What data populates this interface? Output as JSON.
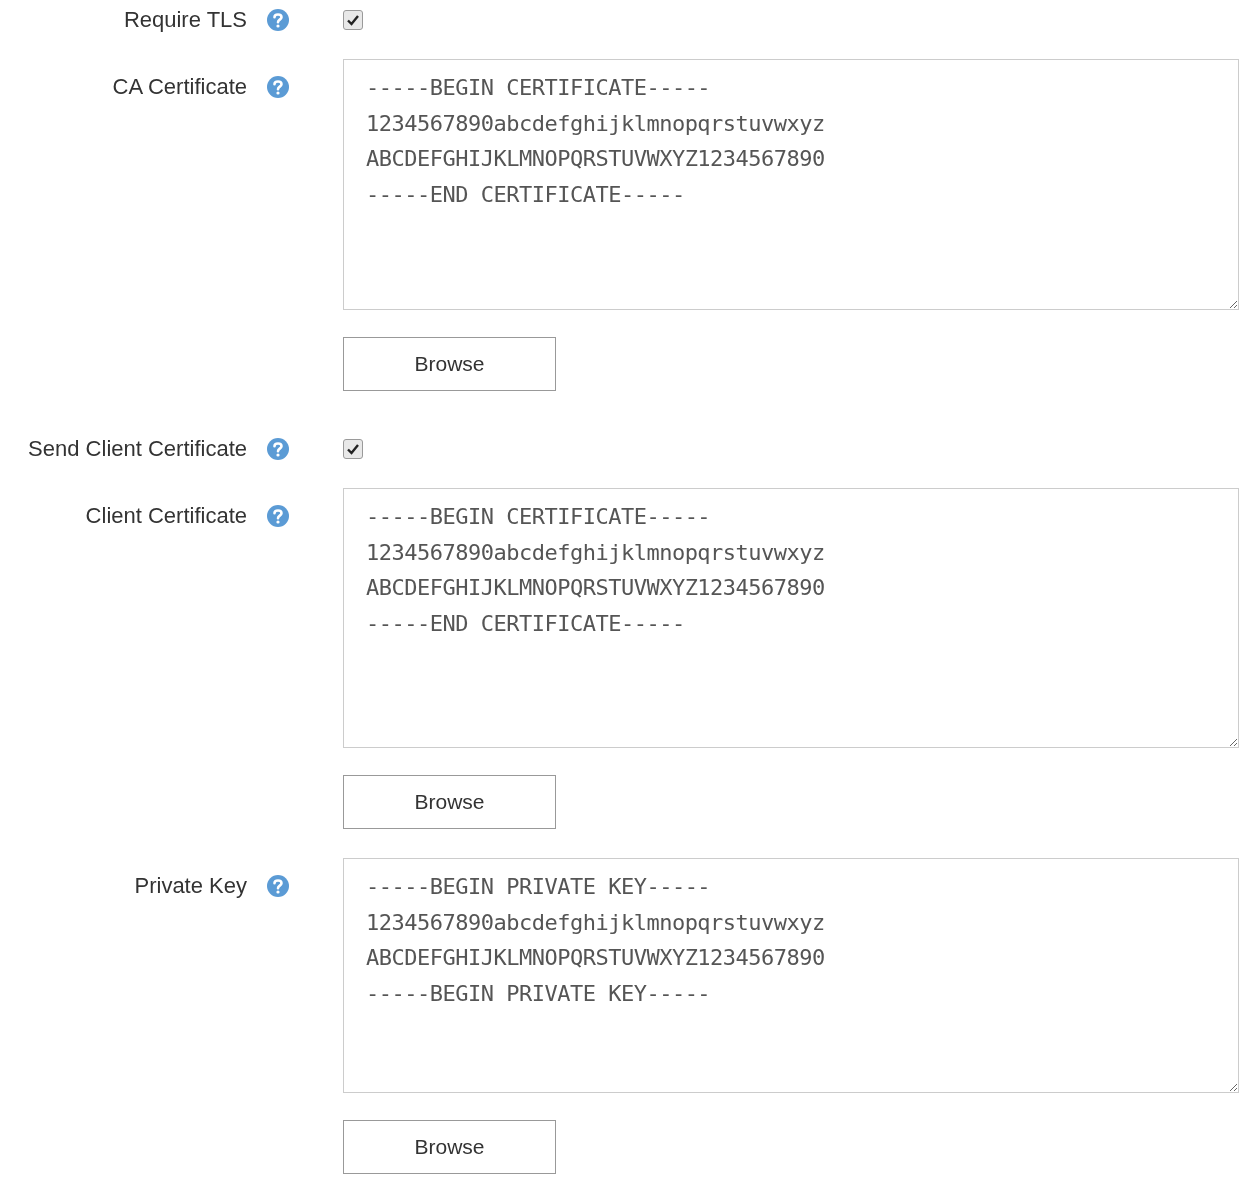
{
  "fields": [
    {
      "kind": "checkbox",
      "label": "Require TLS",
      "checked": true
    },
    {
      "kind": "textarea",
      "label": "CA Certificate",
      "value": "-----BEGIN CERTIFICATE-----\n1234567890abcdefghijklmnopqrstuvwxyz\nABCDEFGHIJKLMNOPQRSTUVWXYZ1234567890\n-----END CERTIFICATE-----",
      "button": "Browse"
    },
    {
      "kind": "checkbox",
      "label": "Send Client Certificate",
      "checked": true
    },
    {
      "kind": "textarea",
      "label": "Client Certificate",
      "value": "-----BEGIN CERTIFICATE-----\n1234567890abcdefghijklmnopqrstuvwxyz\nABCDEFGHIJKLMNOPQRSTUVWXYZ1234567890\n-----END CERTIFICATE-----",
      "button": "Browse"
    },
    {
      "kind": "textarea",
      "label": "Private Key",
      "value": "-----BEGIN PRIVATE KEY-----\n1234567890abcdefghijklmnopqrstuvwxyz\nABCDEFGHIJKLMNOPQRSTUVWXYZ1234567890\n-----BEGIN PRIVATE KEY-----",
      "button": "Browse"
    }
  ]
}
